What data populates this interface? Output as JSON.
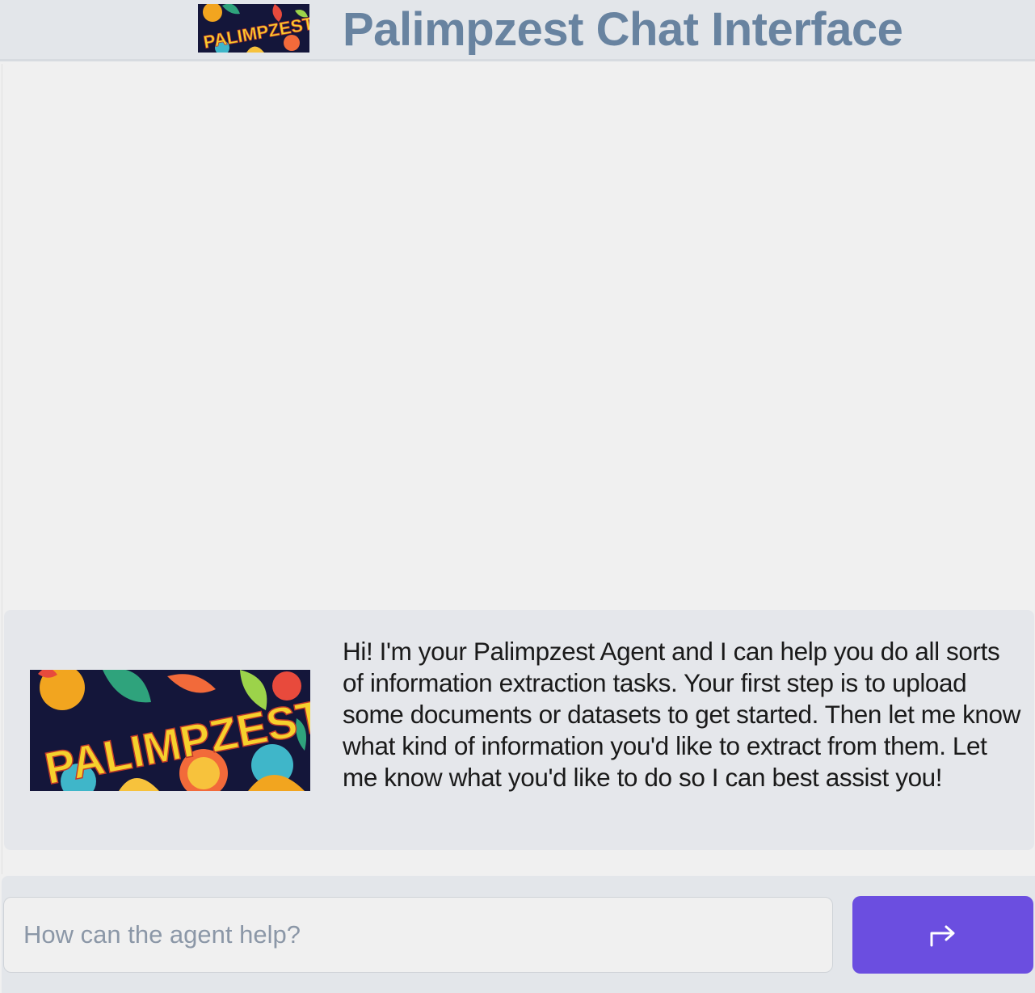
{
  "header": {
    "logo_text": "PALIMPZEST",
    "title": "Palimpzest Chat Interface"
  },
  "chat": {
    "messages": [
      {
        "role": "agent",
        "avatar_text": "PALIMPZEST",
        "text": "Hi! I'm your Palimpzest Agent and I can help you do all sorts of information extraction tasks. Your first step is to upload some documents or datasets to get started. Then let me know what kind of information you'd like to extract from them. Let me know what you'd like to do so I can best assist you!"
      }
    ]
  },
  "input": {
    "placeholder": "How can the agent help?",
    "value": ""
  },
  "send_button": {
    "icon": "send-arrow-icon"
  },
  "colors": {
    "title": "#6883a0",
    "accent": "#6b4ee0",
    "header_bg": "#e3e6ea",
    "message_bg": "#e5e7eb"
  }
}
